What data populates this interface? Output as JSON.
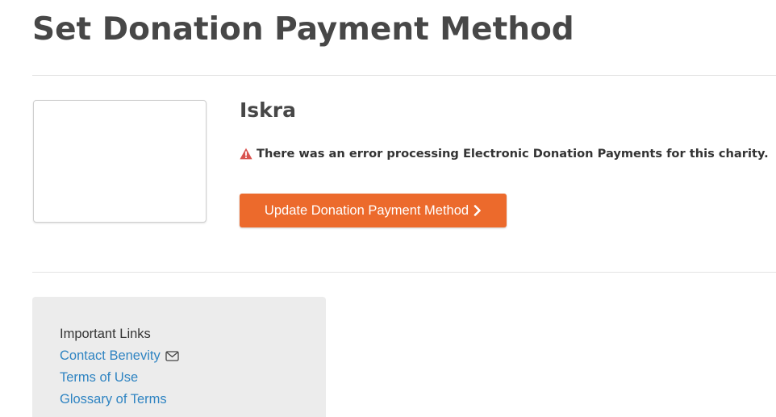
{
  "page": {
    "title": "Set Donation Payment Method"
  },
  "charity": {
    "name": "Iskra",
    "error_message": "There was an error processing Electronic Donation Payments for this charity.",
    "update_button_label": "Update Donation Payment Method"
  },
  "links_panel": {
    "heading": "Important Links",
    "links": [
      {
        "label": "Contact Benevity",
        "icon": "envelope-icon"
      },
      {
        "label": "Terms of Use"
      },
      {
        "label": "Glossary of Terms"
      }
    ]
  },
  "colors": {
    "accent_button": "#ec6a2c",
    "link": "#2f84c2",
    "warning": "#d9534f"
  },
  "icons": {
    "warning": "warning-triangle-icon",
    "chevron": "chevron-right-icon",
    "email": "envelope-icon"
  }
}
